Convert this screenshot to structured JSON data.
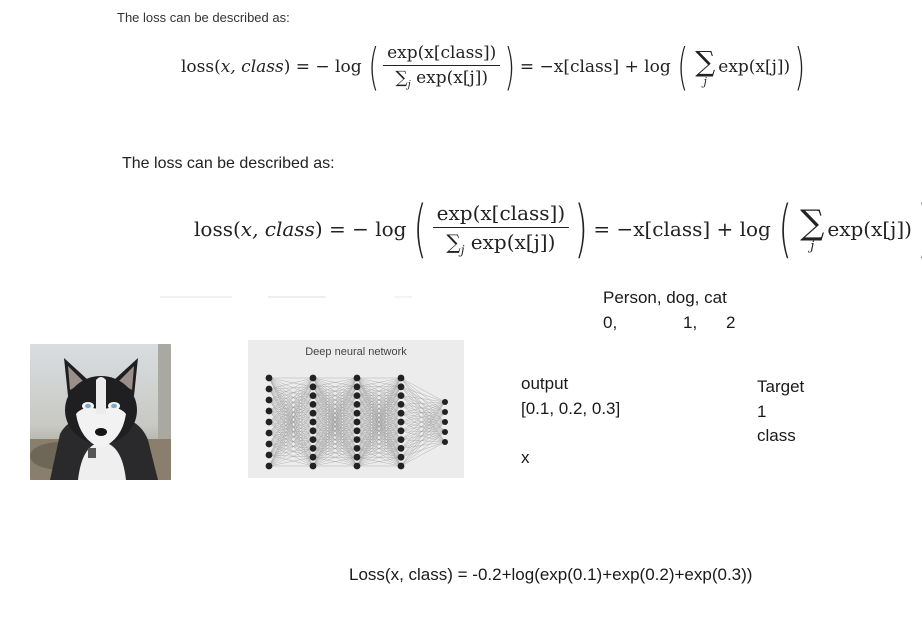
{
  "formula_small": {
    "heading": "The loss can be described as:",
    "lhs": "loss(",
    "x": "x",
    "comma_class": ", class",
    "eq": ") = − log",
    "num": "exp(x[class])",
    "den_sum": "∑",
    "den_sub": "j",
    "den_rest": " exp(x[j])",
    "mid": " = −x[class] + log",
    "sum": "∑",
    "sum_sub": "j",
    "tail": "exp(x[j])"
  },
  "formula_large": {
    "heading": "The loss can be described as:",
    "lhs": "loss(",
    "x": "x",
    "comma_class": ", class",
    "eq": ") = − log",
    "num": "exp(x[class])",
    "den_sum": "∑",
    "den_sub": "j",
    "den_rest": " exp(x[j])",
    "mid": " = −x[class] + log",
    "sum": "∑",
    "sum_sub": "j",
    "tail": "exp(x[j])"
  },
  "classes": {
    "names": "Person, dog, cat",
    "idx0": "0,",
    "idx1": "1,",
    "idx2": "2"
  },
  "output": {
    "label": "output",
    "values": "[0.1, 0.2, 0.3]",
    "var": "x"
  },
  "target": {
    "label": "Target",
    "value": "1",
    "desc": "class"
  },
  "dnn": {
    "title": "Deep neural network"
  },
  "loss_example": "Loss(x, class) = -0.2+log(exp(0.1)+exp(0.2)+exp(0.3))"
}
